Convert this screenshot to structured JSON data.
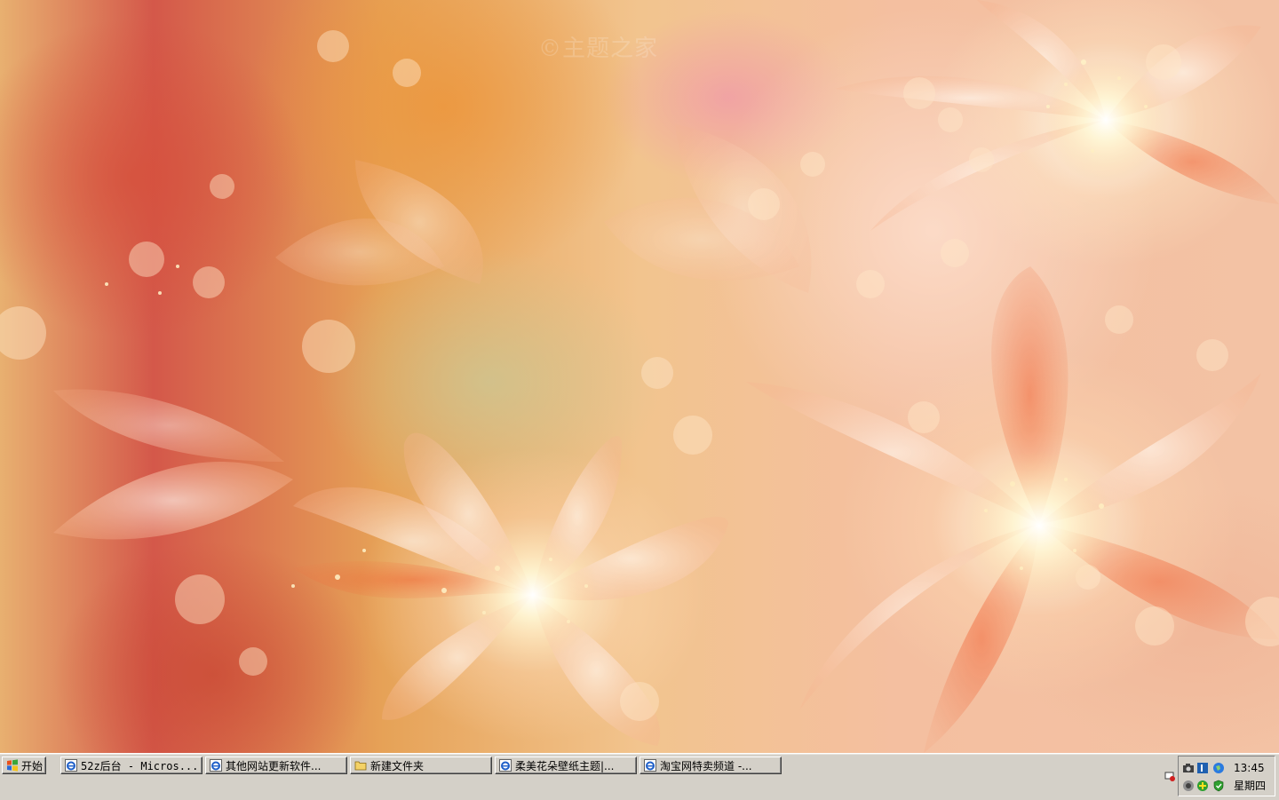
{
  "desktop": {
    "watermark": "©主题之家"
  },
  "taskbar": {
    "start_label": "开始",
    "windows": [
      {
        "label": "52z后台 - Micros...",
        "icon": "ie-icon"
      },
      {
        "label": "其他网站更新软件...",
        "icon": "ie-icon"
      },
      {
        "label": "新建文件夹",
        "icon": "folder-icon"
      },
      {
        "label": "柔美花朵壁纸主题|...",
        "icon": "ie-icon"
      },
      {
        "label": "淘宝网特卖频道 -...",
        "icon": "ie-icon"
      }
    ],
    "tray": {
      "time": "13:45",
      "day": "星期四"
    }
  }
}
